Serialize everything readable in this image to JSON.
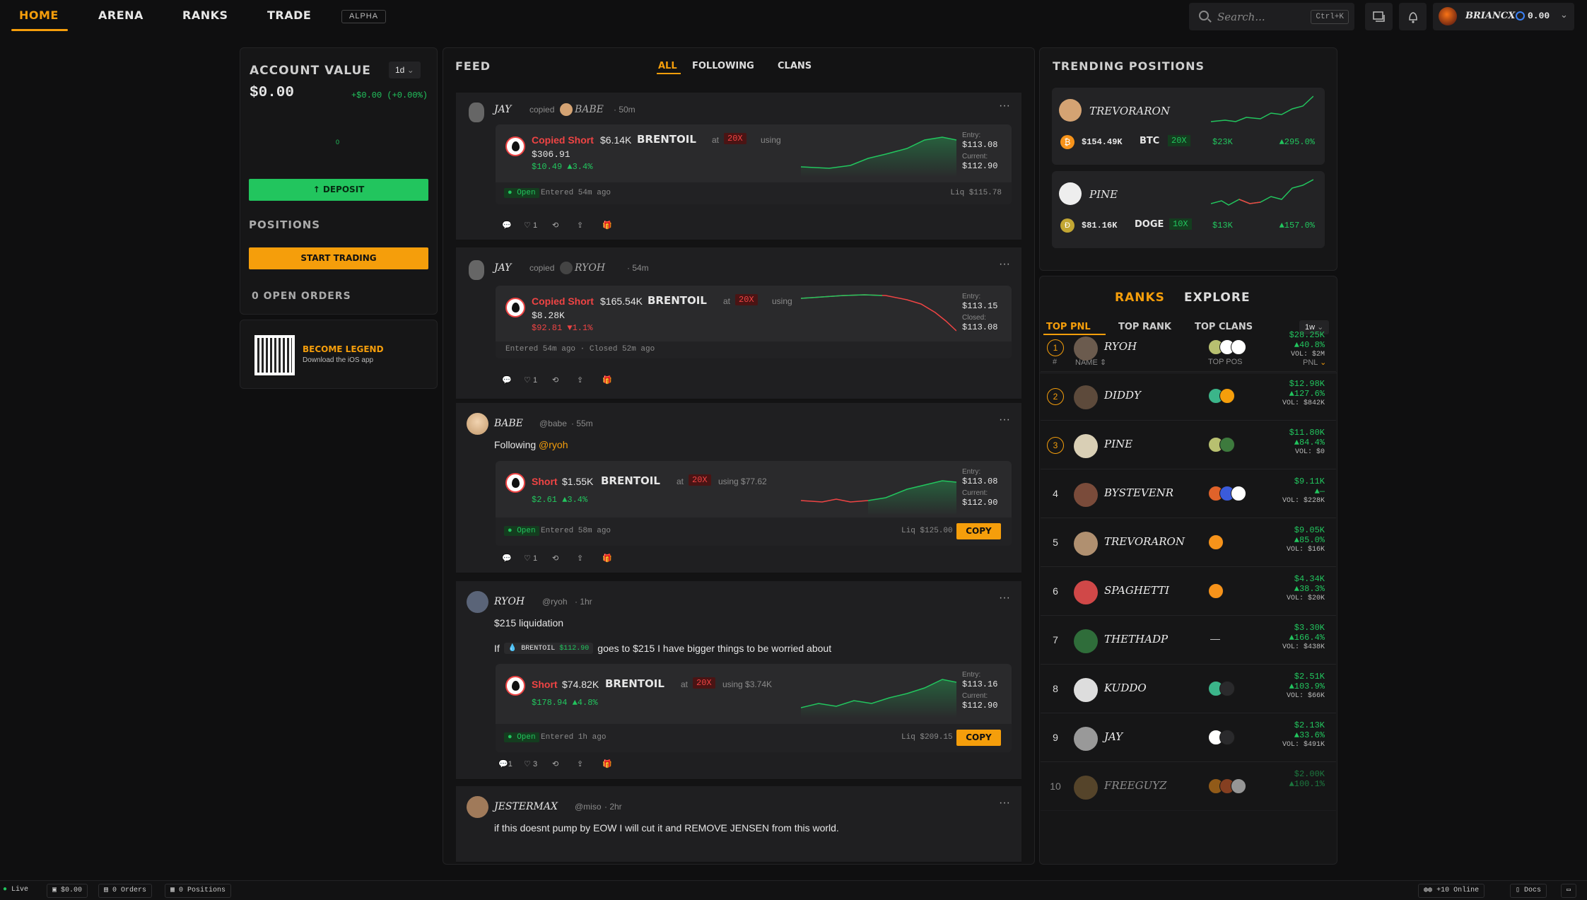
{
  "nav": {
    "items": [
      "HOME",
      "ARENA",
      "RANKS",
      "TRADE"
    ],
    "alpha": "ALPHA",
    "search_placeholder": "Search...",
    "search_kbd": "Ctrl+K",
    "user": "BRIANCX",
    "balance": "0.00"
  },
  "account": {
    "title": "ACCOUNT VALUE",
    "period": "1d",
    "value": "$0.00",
    "change": "+$0.00 (+0.00%)",
    "chart_point": "0",
    "deposit": "DEPOSIT",
    "positions_title": "POSITIONS",
    "start_trading": "START TRADING",
    "open_orders": "0 OPEN ORDERS",
    "legend_title": "BECOME LEGEND",
    "legend_sub": "Download the iOS app"
  },
  "feed": {
    "title": "FEED",
    "tabs": [
      "ALL",
      "FOLLOWING",
      "CLANS"
    ],
    "posts": [
      {
        "user": "JAY",
        "action": "copied",
        "target": "BABE",
        "time": "· 50m",
        "trade": {
          "label": "Copied Short",
          "size": "$6.14K",
          "asset": "BRENTOIL",
          "at": "at",
          "lev": "20X",
          "using": "using",
          "margin": "$306.91",
          "pnl": "$10.49 ▲3.4%",
          "entry_label": "Entry:",
          "entry": "$113.08",
          "cur_label": "Current:",
          "cur": "$112.90",
          "status": "Open",
          "entered": "Entered 54m ago",
          "liq": "Liq $115.78"
        },
        "likes": "1"
      },
      {
        "user": "JAY",
        "action": "copied",
        "target": "RYOH",
        "time": "· 54m",
        "trade": {
          "label": "Copied Short",
          "size": "$165.54K",
          "asset": "BRENTOIL",
          "at": "at",
          "lev": "20X",
          "using": "using",
          "margin": "$8.28K",
          "pnl": "$92.81 ▼1.1%",
          "entry_label": "Entry:",
          "entry": "$113.15",
          "cur_label": "Closed:",
          "cur": "$113.08",
          "entered": "Entered 54m ago · Closed 52m ago"
        },
        "likes": "1"
      },
      {
        "user": "BABE",
        "handle": "@babe",
        "time": "· 55m",
        "text": "Following",
        "mention": "@ryoh",
        "trade": {
          "label": "Short",
          "size": "$1.55K",
          "asset": "BRENTOIL",
          "at": "at",
          "lev": "20X",
          "using": "using $77.62",
          "pnl": "$2.61 ▲3.4%",
          "entry_label": "Entry:",
          "entry": "$113.08",
          "cur_label": "Current:",
          "cur": "$112.90",
          "status": "Open",
          "entered": "Entered 58m ago",
          "liq": "Liq $125.00",
          "copy": "COPY"
        },
        "likes": "1"
      },
      {
        "user": "RYOH",
        "handle": "@ryoh",
        "time": "· 1hr",
        "text": "$215 liquidation",
        "text2_pre": "If",
        "chip_asset": "BRENTOIL",
        "chip_price": "$112.90",
        "text2_post": "goes to $215 I have bigger things to be worried about",
        "trade": {
          "label": "Short",
          "size": "$74.82K",
          "asset": "BRENTOIL",
          "at": "at",
          "lev": "20X",
          "using": "using $3.74K",
          "pnl": "$178.94 ▲4.8%",
          "entry_label": "Entry:",
          "entry": "$113.16",
          "cur_label": "Current:",
          "cur": "$112.90",
          "status": "Open",
          "entered": "Entered 1h ago",
          "liq": "Liq $209.15",
          "copy": "COPY"
        },
        "comments": "1",
        "likes": "3"
      },
      {
        "user": "JESTERMAX",
        "handle": "@miso",
        "time": "· 2hr",
        "text": "if this doesnt pump by EOW I will cut it and REMOVE JENSEN from this world."
      }
    ]
  },
  "trending": {
    "title": "TRENDING POSITIONS",
    "items": [
      {
        "user": "TREVORARON",
        "amount": "$154.49K",
        "asset": "BTC",
        "lev": "20X",
        "margin": "$23K",
        "pct": "▲295.0%"
      },
      {
        "user": "PINE",
        "amount": "$81.16K",
        "asset": "DOGE",
        "lev": "10X",
        "margin": "$13K",
        "pct": "▲157.0%"
      }
    ]
  },
  "ranks": {
    "tabs": [
      "RANKS",
      "EXPLORE"
    ],
    "subtabs": [
      "TOP PNL",
      "TOP RANK",
      "TOP CLANS"
    ],
    "period": "1w",
    "cols": [
      "#",
      "NAME",
      "TOP POS",
      "PNL"
    ],
    "rows": [
      {
        "rank": "1",
        "name": "RYOH",
        "pnl": "$28.25K",
        "pct": "▲40.8%",
        "vol": "VOL: $2M"
      },
      {
        "rank": "2",
        "name": "DIDDY",
        "pnl": "$12.98K",
        "pct": "▲127.6%",
        "vol": "VOL: $842K"
      },
      {
        "rank": "3",
        "name": "PINE",
        "pnl": "$11.80K",
        "pct": "▲84.4%",
        "vol": "VOL: $0"
      },
      {
        "rank": "4",
        "name": "BYSTEVENR",
        "pnl": "$9.11K",
        "pct": "▲—",
        "vol": "VOL: $228K"
      },
      {
        "rank": "5",
        "name": "TREVORARON",
        "pnl": "$9.05K",
        "pct": "▲85.0%",
        "vol": "VOL: $16K"
      },
      {
        "rank": "6",
        "name": "SPAGHETTI",
        "pnl": "$4.34K",
        "pct": "▲38.3%",
        "vol": "VOL: $20K"
      },
      {
        "rank": "7",
        "name": "THETHADP",
        "pnl": "$3.30K",
        "pct": "▲166.4%",
        "vol": "VOL: $438K",
        "toppos": "—"
      },
      {
        "rank": "8",
        "name": "KUDDO",
        "pnl": "$2.51K",
        "pct": "▲103.9%",
        "vol": "VOL: $66K"
      },
      {
        "rank": "9",
        "name": "JAY",
        "pnl": "$2.13K",
        "pct": "▲33.6%",
        "vol": "VOL: $491K"
      },
      {
        "rank": "10",
        "name": "FREEGUYZ",
        "pnl": "$2.00K",
        "pct": "▲100.1%",
        "vol": ""
      }
    ]
  },
  "footer": {
    "live": "Live",
    "balance": "$0.00",
    "orders": "0 Orders",
    "positions": "0 Positions",
    "online": "+10 Online",
    "docs": "Docs"
  },
  "colors": {
    "accent": "#f59e0b",
    "profit": "#22c55e",
    "loss": "#ef4444",
    "background": "#0f0f10"
  }
}
